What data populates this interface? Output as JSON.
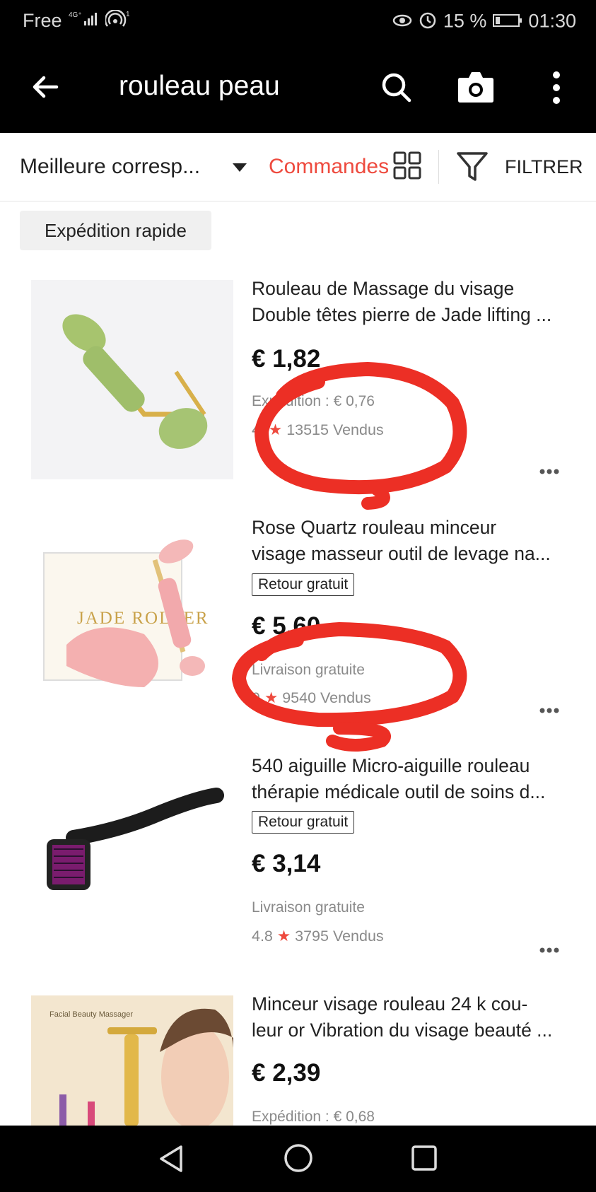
{
  "status_bar": {
    "carrier": "Free",
    "network": "4G⁺",
    "hotspot": "1",
    "battery": "15 %",
    "time": "01:30"
  },
  "app_bar": {
    "query": "rouleau peau"
  },
  "sort_bar": {
    "sort_label": "Meilleure corresp...",
    "orders_label": "Commandes",
    "filter_label": "FILTRER"
  },
  "chips": {
    "fast_shipping": "Expédition rapide"
  },
  "products": [
    {
      "title_line1": "Rouleau de Massage du visage",
      "title_line2": "Double têtes pierre de Jade lifting ...",
      "price": "€ 1,82",
      "shipping": "Expédition : € 0,76",
      "rating": "4.",
      "sold": "13515 Vendus",
      "thumb_color": "#9fbe6a"
    },
    {
      "title_line1": "Rose Quartz rouleau minceur",
      "title_line2": "visage masseur outil de levage na...",
      "badge": "Retour gratuit",
      "price": "€ 5,60",
      "shipping": "Livraison gratuite",
      "rating": "9",
      "sold": "9540 Vendus",
      "thumb_text": "JADE ROLLER",
      "thumb_color": "#f4b8b8"
    },
    {
      "title_line1": "540 aiguille Micro-aiguille rouleau",
      "title_line2": "thérapie médicale outil de soins d...",
      "badge": "Retour gratuit",
      "price": "€ 3,14",
      "shipping": "Livraison gratuite",
      "rating": "4.8",
      "sold": "3795 Vendus",
      "thumb_color": "#222222"
    },
    {
      "title_line1": "Minceur visage rouleau 24 k cou-",
      "title_line2": "leur or Vibration du visage beauté ...",
      "price": "€ 2,39",
      "shipping": "Expédition : € 0,68",
      "thumb_text": "Facial Beauty Massager",
      "thumb_color": "#f1e5cf"
    }
  ],
  "colors": {
    "accent": "#ee4a3e",
    "annotation": "#ec2f25"
  }
}
